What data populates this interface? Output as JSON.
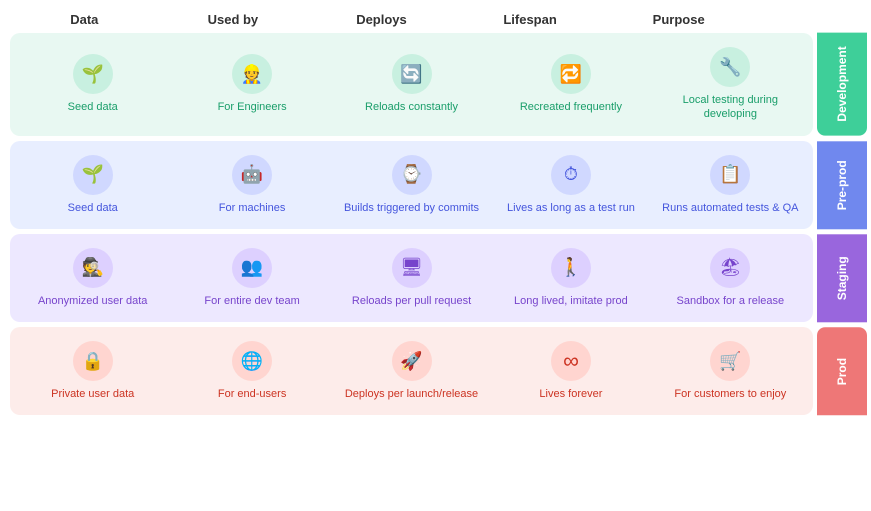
{
  "headers": [
    "Data",
    "Used by",
    "Deploys",
    "Lifespan",
    "Purpose"
  ],
  "rows": [
    {
      "env": "Development",
      "colorClass": "dev",
      "cells": [
        {
          "icon": "🌱",
          "label": "Seed data"
        },
        {
          "icon": "👷",
          "label": "For Engineers"
        },
        {
          "icon": "🔄",
          "label": "Reloads constantly"
        },
        {
          "icon": "🔁",
          "label": "Recreated frequently"
        },
        {
          "icon": "🔧",
          "label": "Local testing during developing"
        }
      ]
    },
    {
      "env": "Pre-prod",
      "colorClass": "test",
      "cells": [
        {
          "icon": "🌱",
          "label": "Seed data"
        },
        {
          "icon": "🤖",
          "label": "For machines"
        },
        {
          "icon": "⌚",
          "label": "Builds triggered by commits"
        },
        {
          "icon": "⏱",
          "label": "Lives as long as a test run"
        },
        {
          "icon": "📋",
          "label": "Runs automated tests & QA"
        }
      ]
    },
    {
      "env": "Staging",
      "colorClass": "staging",
      "cells": [
        {
          "icon": "🕵️",
          "label": "Anonymized user data"
        },
        {
          "icon": "👥",
          "label": "For entire dev team"
        },
        {
          "icon": "🖥",
          "label": "Reloads per pull request"
        },
        {
          "icon": "🚶",
          "label": "Long lived, imitate prod"
        },
        {
          "icon": "🏖",
          "label": "Sandbox for a release"
        }
      ]
    },
    {
      "env": "Prod",
      "colorClass": "prod",
      "cells": [
        {
          "icon": "🔒",
          "label": "Private user data"
        },
        {
          "icon": "🌐",
          "label": "For end-users"
        },
        {
          "icon": "🚀",
          "label": "Deploys per launch/release"
        },
        {
          "icon": "∞",
          "label": "Lives forever"
        },
        {
          "icon": "🛒",
          "label": "For customers to enjoy"
        }
      ]
    }
  ]
}
